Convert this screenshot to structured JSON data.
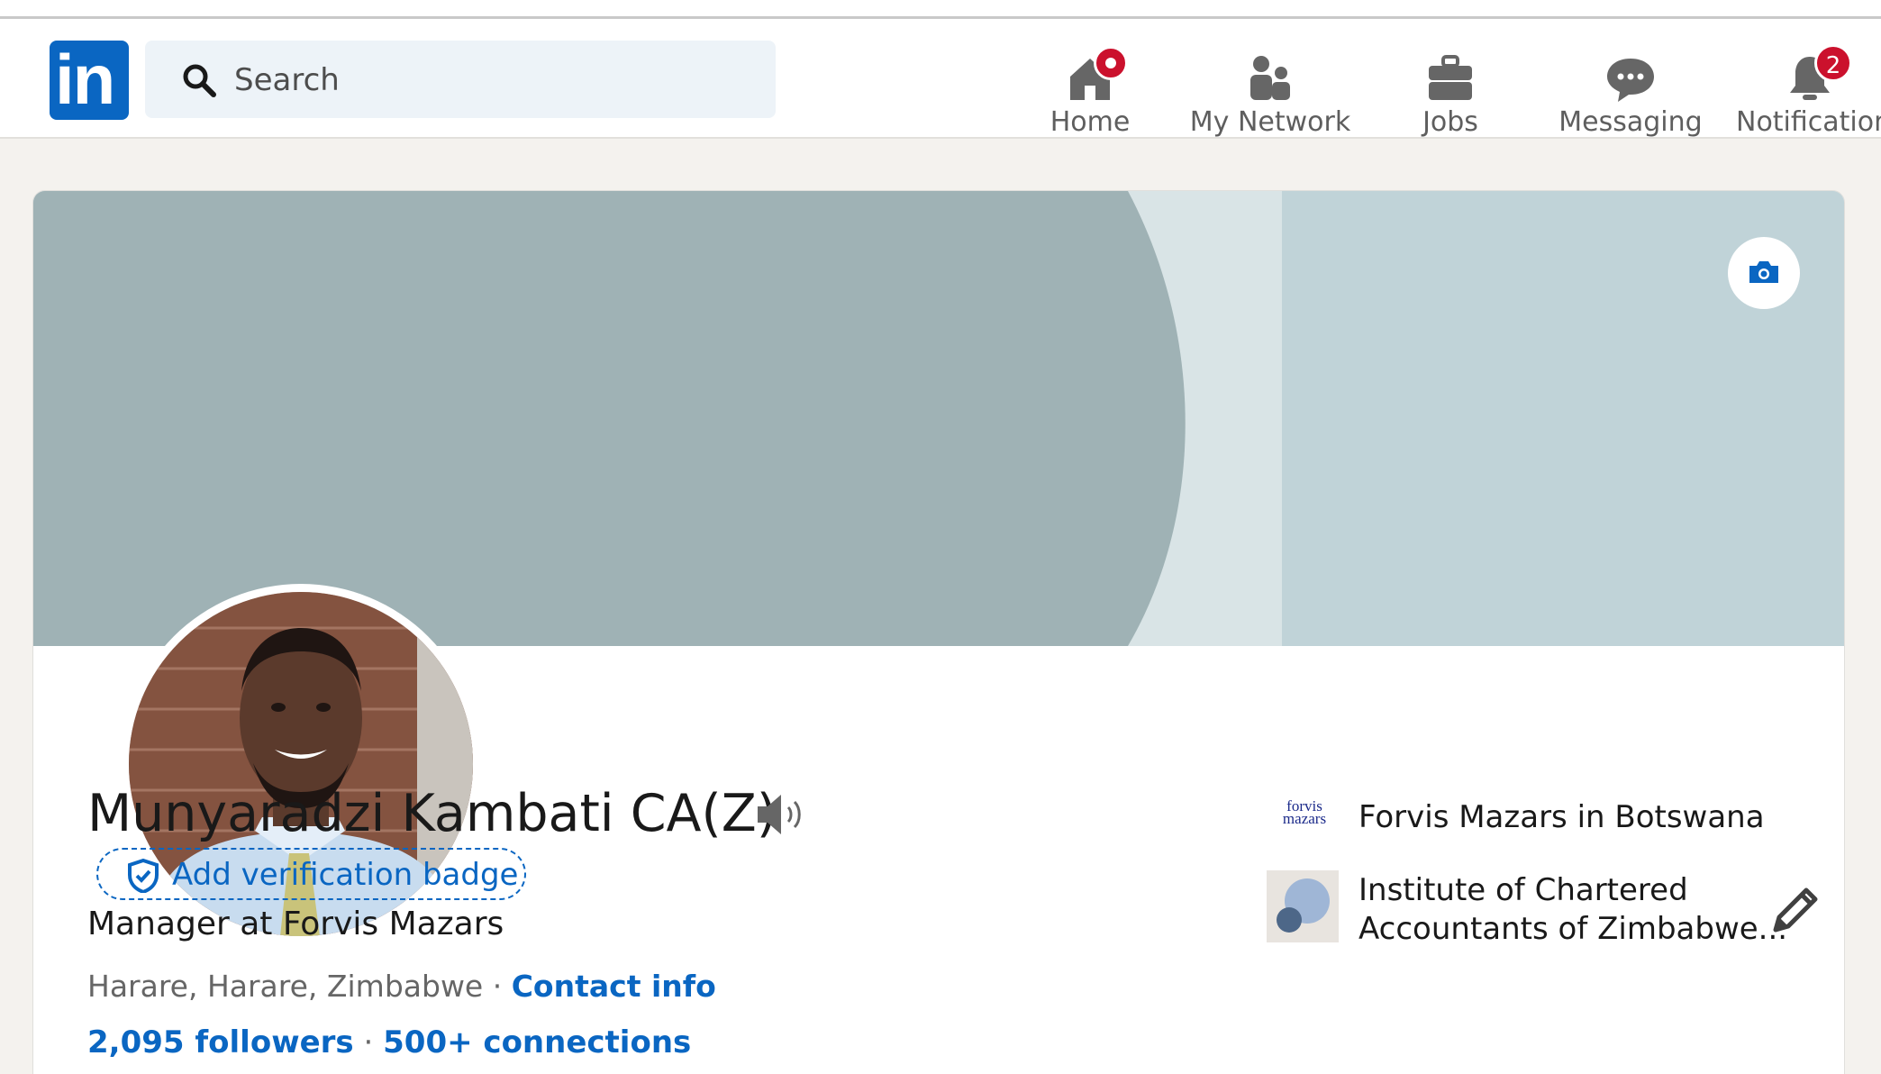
{
  "nav": {
    "logo_text": "in",
    "search_placeholder": "Search",
    "items": [
      {
        "label": "Home",
        "icon": "home-icon"
      },
      {
        "label": "My Network",
        "icon": "network-icon"
      },
      {
        "label": "Jobs",
        "icon": "briefcase-icon"
      },
      {
        "label": "Messaging",
        "icon": "messaging-icon"
      },
      {
        "label": "Notifications",
        "icon": "bell-icon",
        "badge": "2"
      }
    ]
  },
  "profile": {
    "name": "Munyaradzi Kambati CA(Z)",
    "verification_label": "Add verification badge",
    "headline": "Manager at Forvis Mazars",
    "location": "Harare, Harare, Zimbabwe",
    "location_sep": " · ",
    "contact_info": "Contact info",
    "followers": "2,095 followers",
    "stats_sep": " · ",
    "connections": "500+ connections"
  },
  "orgs": [
    {
      "logo_text_top": "forvis",
      "logo_text_bottom": "mazars",
      "name": "Forvis Mazars in Botswana"
    },
    {
      "name_line1": "Institute of Chartered",
      "name_line2": "Accountants of Zimbabwe..."
    }
  ],
  "colors": {
    "brand_blue": "#0a66c2",
    "badge_red": "#cb112d",
    "banner_dark": "#9fb2b5",
    "banner_light": "#c0d3d8",
    "page_bg": "#f4f2ee"
  }
}
